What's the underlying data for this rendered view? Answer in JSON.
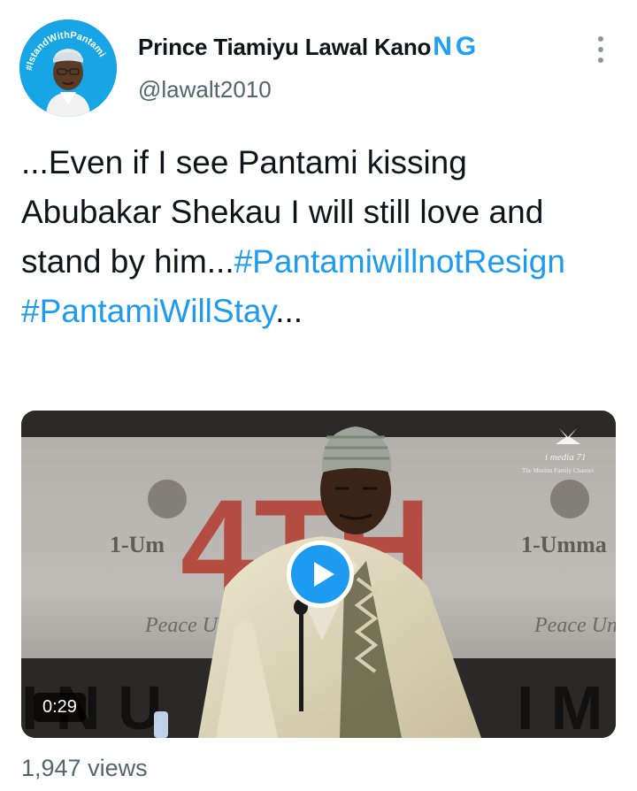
{
  "author": {
    "name": "Prince Tiamiyu Lawal Kano",
    "name_suffix": "NG",
    "handle": "@lawalt2010",
    "avatar_ring_text": "#IstandWithPantami",
    "avatar_bg": "#17a5e6"
  },
  "tweet": {
    "text_plain": "...Even if I see Pantami kissing Abubakar Shekau I will still love and stand by him...",
    "hashtag_1": "#PantamiwillnotResign",
    "hashtag_2": "#PantamiWillStay",
    "trailing": "..."
  },
  "media": {
    "duration": "0:29",
    "watermark_line1": "i media 71",
    "watermark_line2": "The Muslim Family Channel",
    "banner_left": "1-Um",
    "banner_right": "1-Umma",
    "banner_big": "4TH",
    "banner_script": "Peace Unity"
  },
  "footer": {
    "views": "1,947 views"
  },
  "colors": {
    "accent": "#1d9bf0",
    "text": "#0f1419",
    "muted": "#536471"
  },
  "icons": {
    "more": "more-vertical-icon",
    "play": "play-icon"
  }
}
